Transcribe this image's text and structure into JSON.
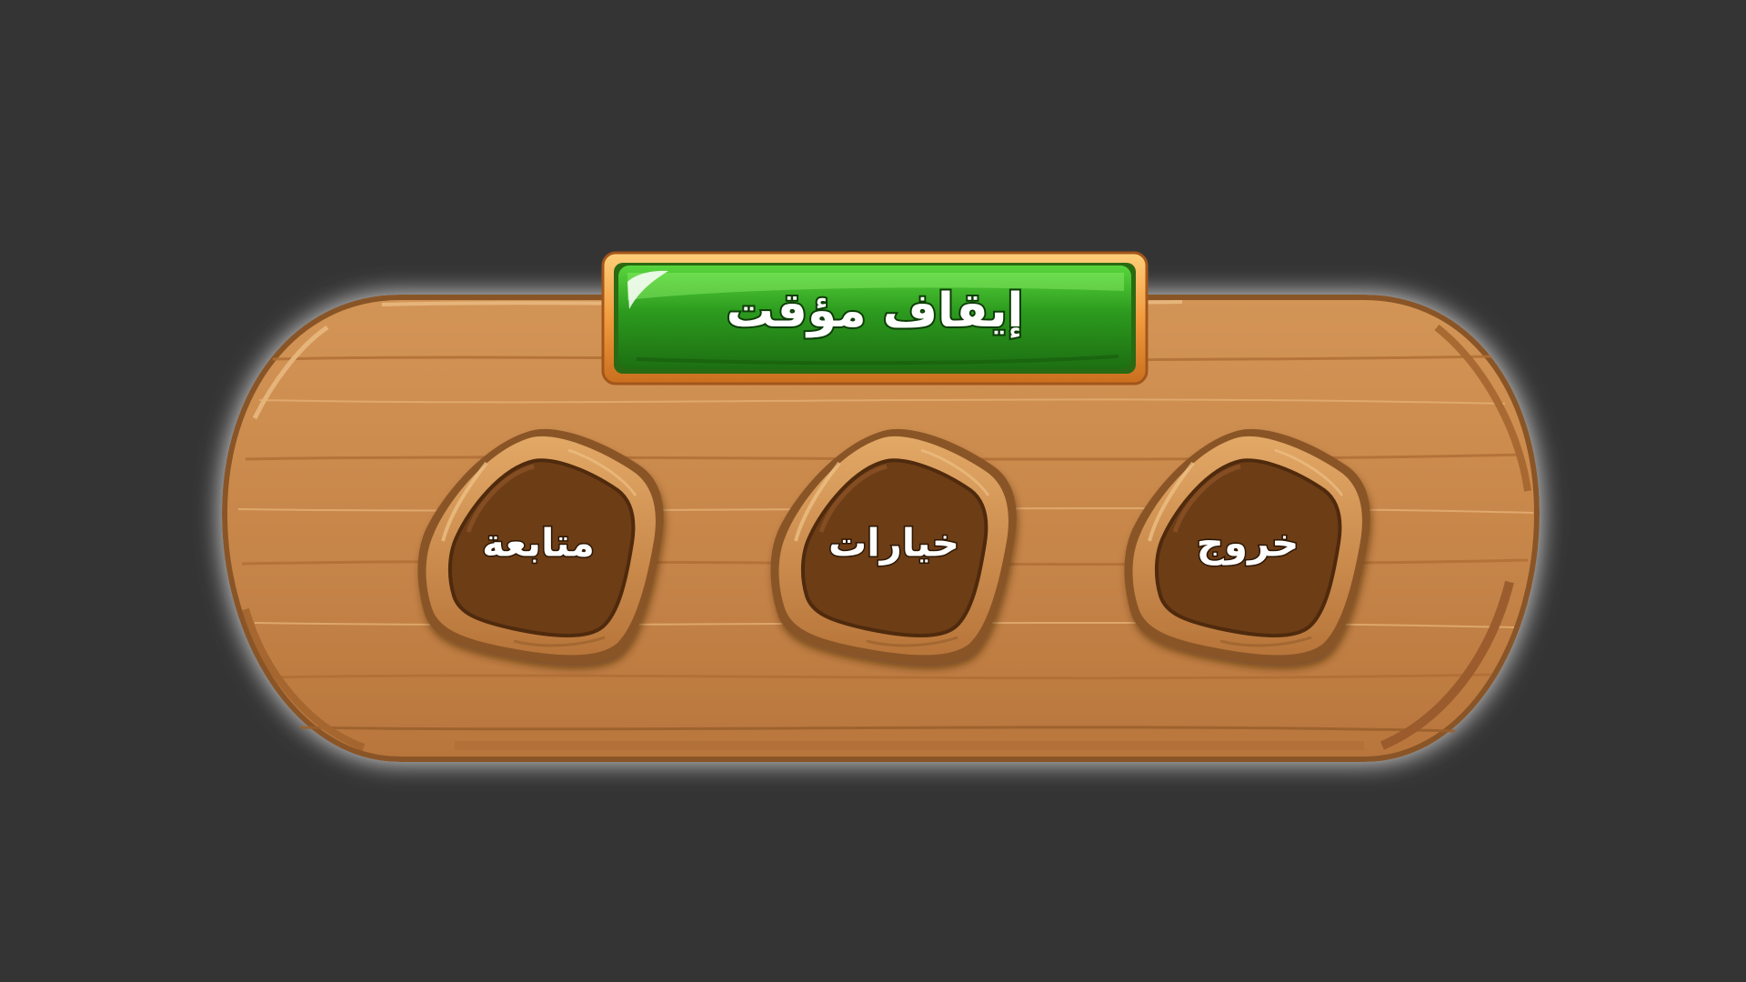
{
  "pause_menu": {
    "title": "إيقاف مؤقت",
    "buttons": {
      "continue": {
        "label": "متابعة",
        "icon": "wooden-pentagon"
      },
      "options": {
        "label": "خيارات",
        "icon": "wooden-pentagon"
      },
      "exit": {
        "label": "خروج",
        "icon": "wooden-pentagon"
      }
    }
  },
  "colors": {
    "background": "#343434",
    "plank": "#c98a4b",
    "plank_dark": "#9a5f2c",
    "plank_light": "#dca567",
    "button_inner": "#6d3d16",
    "title_green": "#2c9a1e",
    "title_frame": "#f0a14a",
    "glow": "#ffffff"
  }
}
